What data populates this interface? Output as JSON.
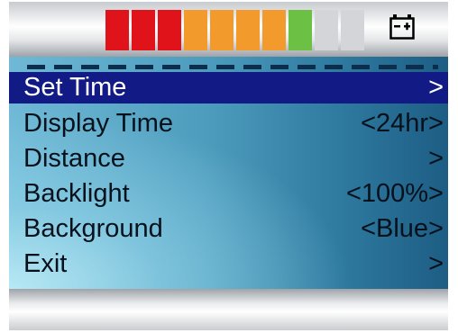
{
  "battery": {
    "segments": [
      {
        "color": "#e0121a"
      },
      {
        "color": "#e0121a"
      },
      {
        "color": "#e0121a"
      },
      {
        "color": "#f39a2c"
      },
      {
        "color": "#f39a2c"
      },
      {
        "color": "#f39a2c"
      },
      {
        "color": "#f39a2c"
      },
      {
        "color": "#6cc043"
      },
      {
        "color": "#d3d5d8"
      },
      {
        "color": "#d3d5d8"
      }
    ],
    "filled_segments": 8,
    "total_segments": 10,
    "icon": "battery-icon"
  },
  "menu": {
    "selected_color": "#111a85",
    "items": [
      {
        "label": "Set Time",
        "value": ">"
      },
      {
        "label": "Display Time",
        "value": "<24hr>"
      },
      {
        "label": "Distance",
        "value": ">"
      },
      {
        "label": "Backlight",
        "value": "<100%>"
      },
      {
        "label": "Background",
        "value": "<Blue>"
      },
      {
        "label": "Exit",
        "value": ">"
      }
    ]
  }
}
